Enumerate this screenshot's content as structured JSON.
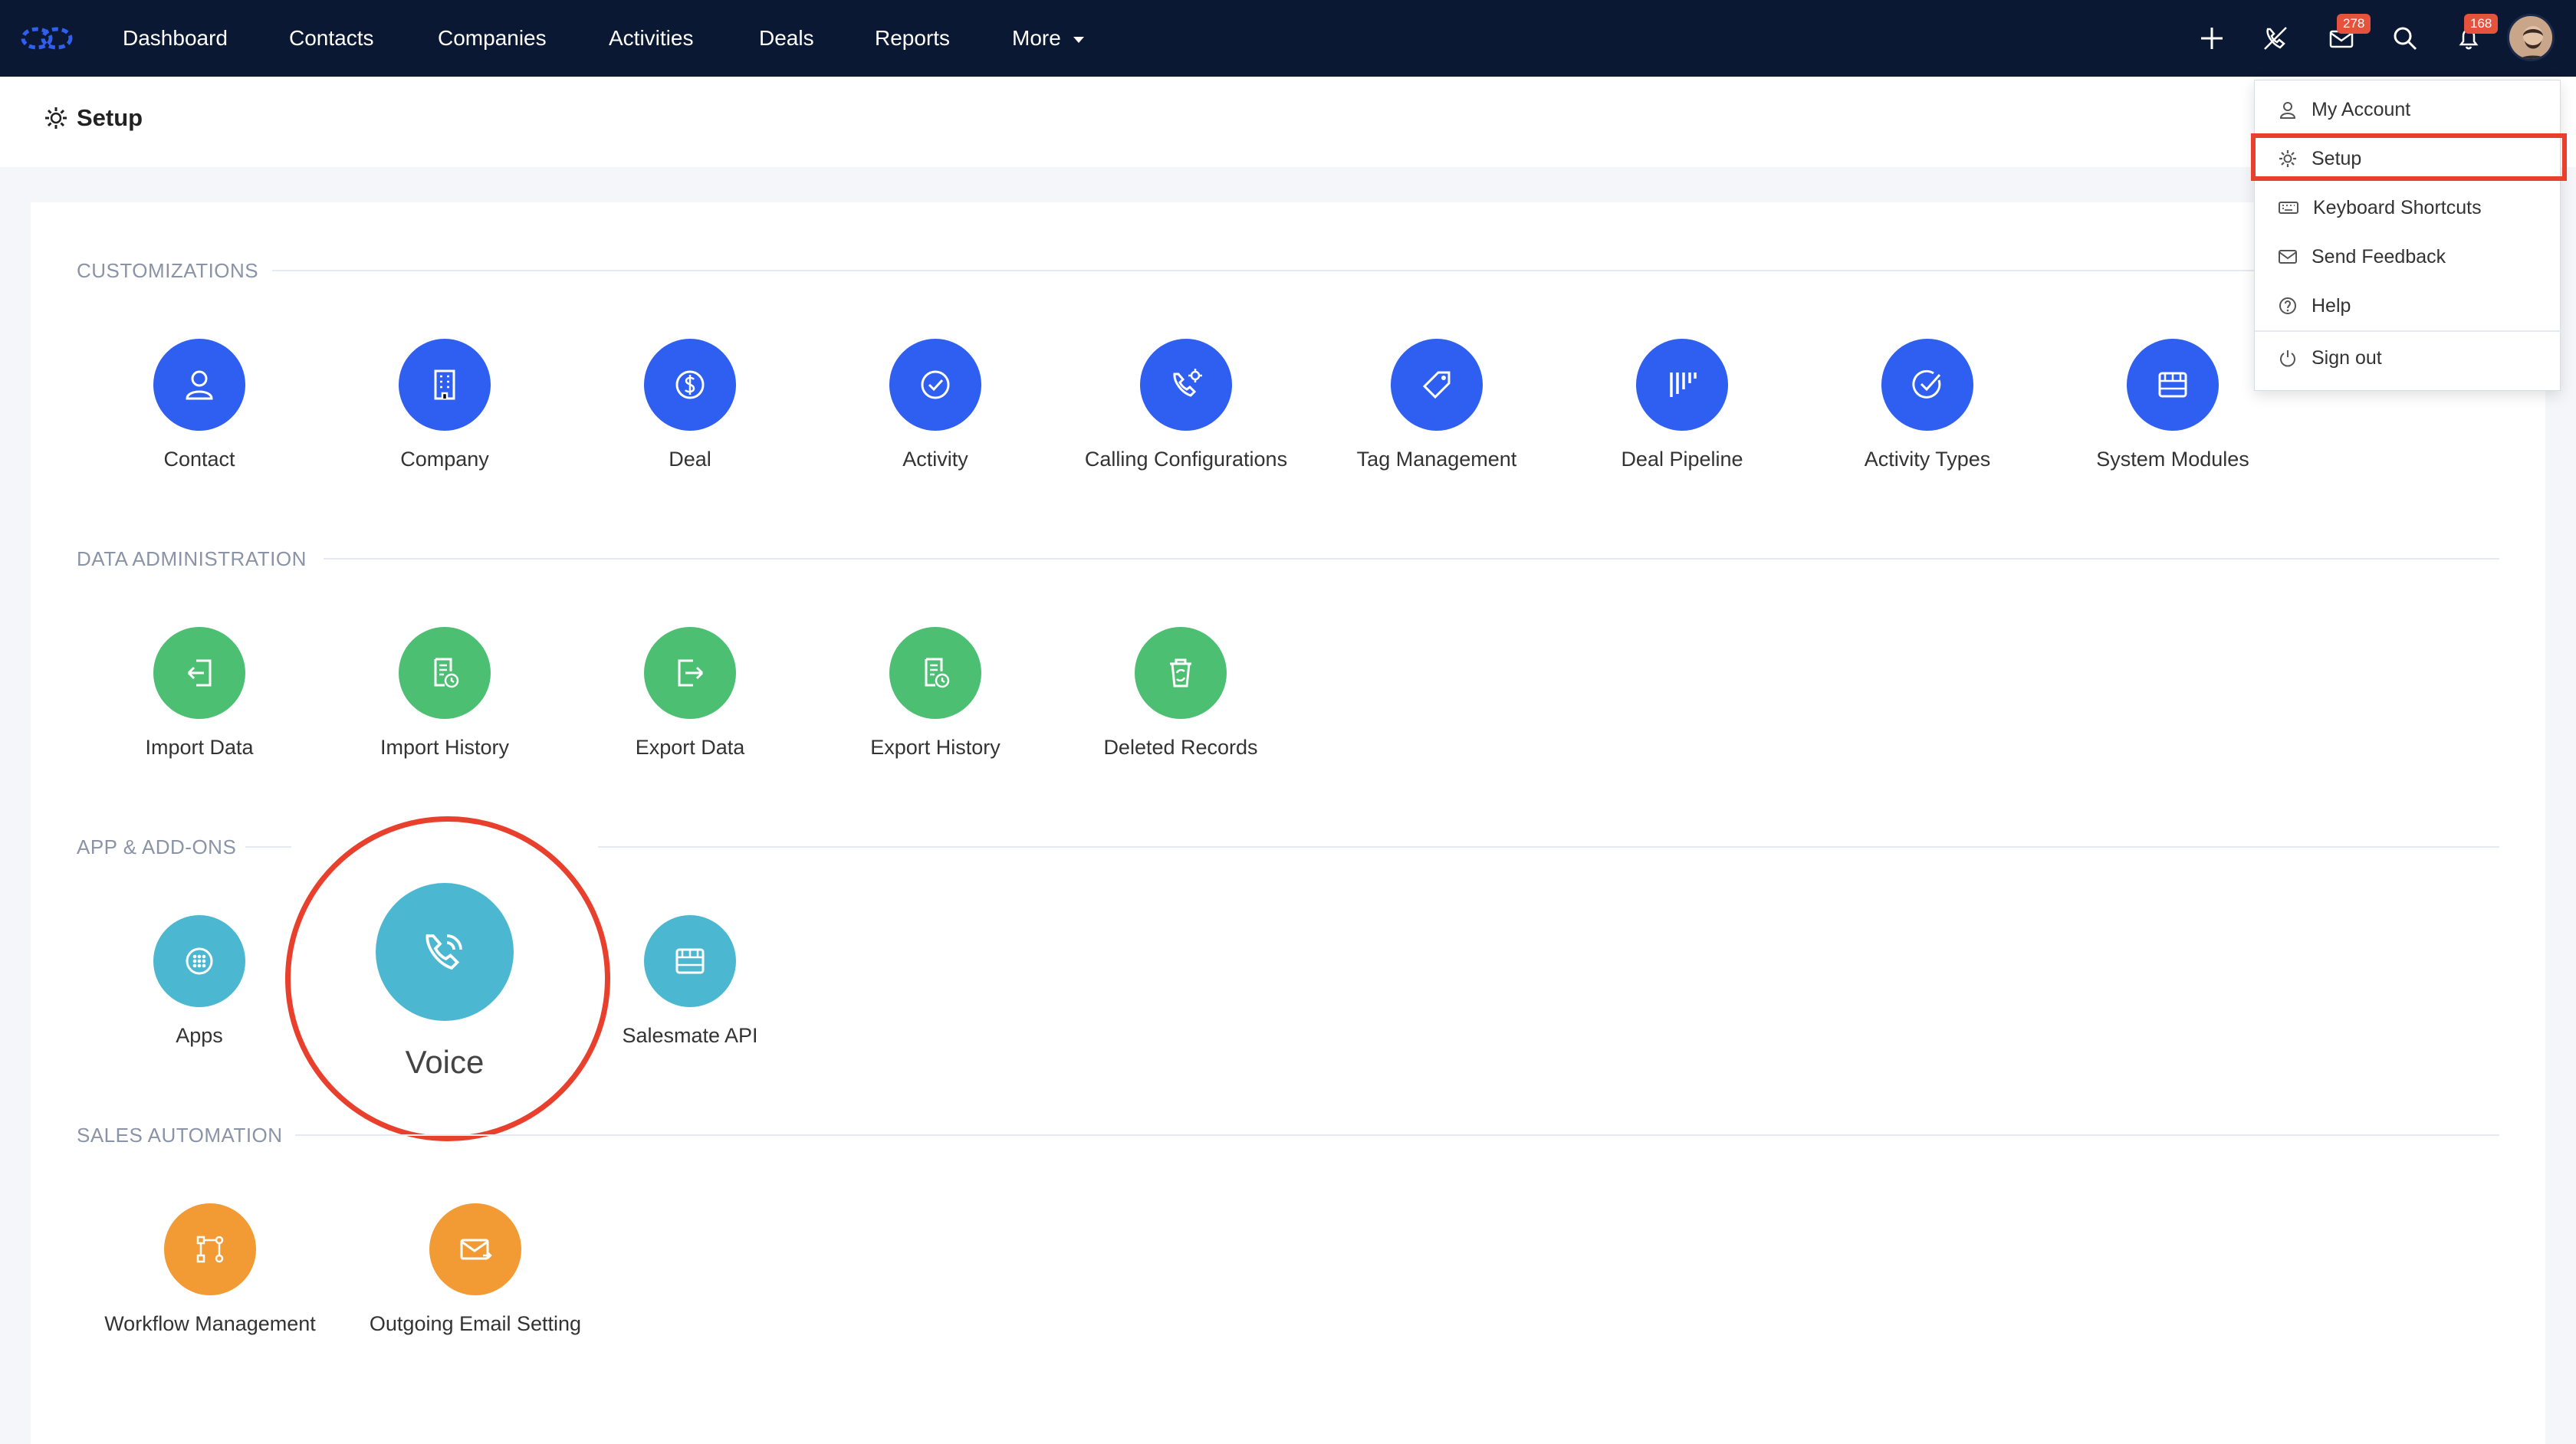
{
  "nav": {
    "items": [
      "Dashboard",
      "Contacts",
      "Companies",
      "Activities",
      "Deals",
      "Reports",
      "More"
    ],
    "email_badge": "278",
    "notification_badge": "168"
  },
  "page": {
    "title": "Setup"
  },
  "sections": {
    "customizations": {
      "title": "CUSTOMIZATIONS",
      "tiles": [
        "Contact",
        "Company",
        "Deal",
        "Activity",
        "Calling Configurations",
        "Tag Management",
        "Deal Pipeline",
        "Activity Types",
        "System Modules"
      ]
    },
    "data_admin": {
      "title": "DATA ADMINISTRATION",
      "tiles": [
        "Import Data",
        "Import History",
        "Export Data",
        "Export History",
        "Deleted Records"
      ]
    },
    "apps": {
      "title": "APP & ADD-ONS",
      "tiles": [
        "Apps",
        "Voice",
        "Salesmate API"
      ]
    },
    "automation": {
      "title": "SALES AUTOMATION",
      "tiles": [
        "Workflow Management",
        "Outgoing Email Setting"
      ]
    }
  },
  "dropdown": {
    "items": [
      "My Account",
      "Setup",
      "Keyboard Shortcuts",
      "Send Feedback",
      "Help",
      "Sign out"
    ]
  },
  "colors": {
    "navbar": "#0a1833",
    "blue": "#2f5ff0",
    "green": "#4cbf73",
    "teal": "#4cb7d1",
    "orange": "#f29a33",
    "highlight": "#e8402c"
  }
}
